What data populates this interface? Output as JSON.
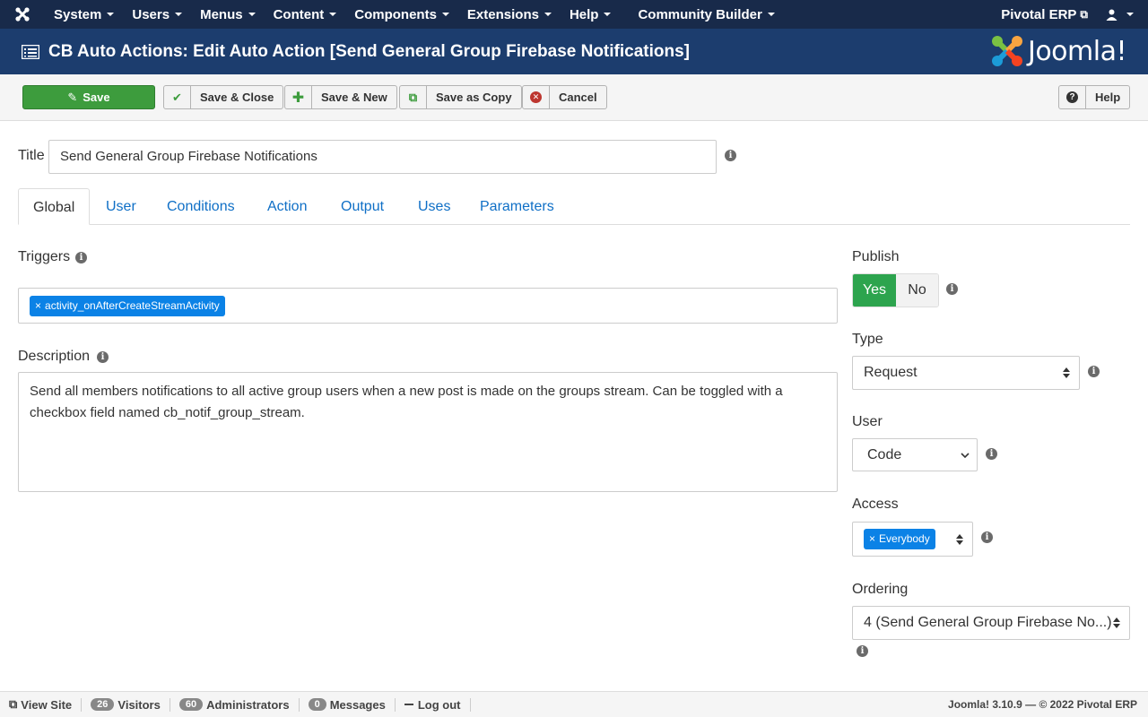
{
  "nav": {
    "items": [
      "System",
      "Users",
      "Menus",
      "Content",
      "Components",
      "Extensions",
      "Help",
      "Community Builder"
    ],
    "site_name": "Pivotal ERP"
  },
  "header": {
    "title": "CB Auto Actions: Edit Auto Action [Send General Group Firebase Notifications]",
    "logo_text": "Joomla!"
  },
  "toolbar": {
    "save": "Save",
    "save_close": "Save & Close",
    "save_new": "Save & New",
    "save_copy": "Save as Copy",
    "cancel": "Cancel",
    "help": "Help"
  },
  "form": {
    "title_label": "Title",
    "title_value": "Send General Group Firebase Notifications",
    "tabs": [
      "Global",
      "User",
      "Conditions",
      "Action",
      "Output",
      "Uses",
      "Parameters"
    ],
    "active_tab": "Global",
    "triggers_label": "Triggers",
    "trigger_chip": "activity_onAfterCreateStreamActivity",
    "description_label": "Description",
    "description_value": "Send all members notifications to all active group users when a new post is made on the groups stream. Can be toggled with a checkbox field named cb_notif_group_stream.",
    "publish_label": "Publish",
    "publish_yes": "Yes",
    "publish_no": "No",
    "type_label": "Type",
    "type_value": "Request",
    "user_label": "User",
    "user_value": "Code",
    "access_label": "Access",
    "access_chip": "Everybody",
    "ordering_label": "Ordering",
    "ordering_value": "4 (Send General Group Firebase No...)"
  },
  "footer": {
    "view_site": "View Site",
    "visitors_count": "26",
    "visitors": "Visitors",
    "admins_count": "60",
    "admins": "Administrators",
    "messages_count": "0",
    "messages": "Messages",
    "logout": "Log out",
    "version": "Joomla! 3.10.9",
    "copyright": "© 2022 Pivotal ERP"
  },
  "colors": {
    "navbar": "#182a4a",
    "header": "#1c3d6e",
    "save_green": "#3d9c3d",
    "publish_yes": "#2da44e",
    "chip_blue": "#0b82e6",
    "link_blue": "#0f6fc6"
  }
}
